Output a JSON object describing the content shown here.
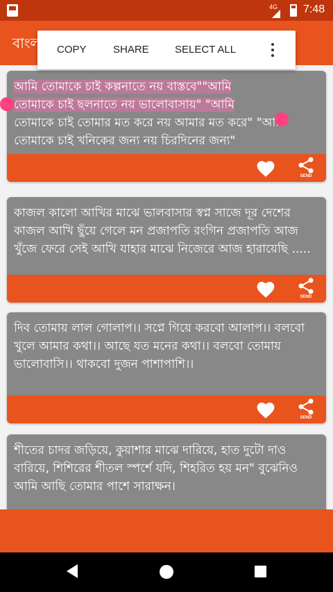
{
  "status_bar": {
    "network": "4G",
    "time": "7:48"
  },
  "app_bar": {
    "title": "বাংলা"
  },
  "context_menu": {
    "copy": "COPY",
    "share": "SHARE",
    "select_all": "SELECT ALL"
  },
  "cards": [
    {
      "line1_selected": "আমি তোমাকে চাই কল্পনাতে নয় বাস্তবে\"\"আমি",
      "line2_selected": "তোমাকে চাই ছলনাতে নয় ভালোবাসায়\" \"আমি",
      "rest": "তোমাকে চাই তোমার মত করে নয় আমার মত করে\" \"আমি তোমাকে চাই খনিকের জন্য নয় চিরদিনের জন্য\"",
      "send_label": "SEND"
    },
    {
      "text": "কাজল কালো আখির মাঝে ভালবাসার স্বপ্ন সাজে দূর দেশের কাজল আখি ছুঁয়ে গেলে মন প্রজাপতি রংগিন প্রজাপতি আজ খুঁজে ফেরে সেই আখি যাহার মাঝে নিজেরে আজ হারায়েছি .....",
      "send_label": "SEND"
    },
    {
      "text": "দিব তোমায় লাল গোলাপ।। সপ্নে গিয়ে করবো আলাপ।। বলবো খুলে আমার কথা।। আছে যত মনের কথা।। বলবো তোমায় ভালোবাসি।। থাকবো দুজন পাশাপাশি।।",
      "send_label": "SEND"
    },
    {
      "text": "শীতের চাদর জড়িয়ে, কুয়াশার মাঝে দারিয়ে, হাত দুটো দাও বারিয়ে, শিশিরের শীতল স্পর্শে যদি, শিহরিত হয় মন\" বুঝেনিও আমি আছি তোমার পাশে সারাক্ষন।"
    }
  ]
}
